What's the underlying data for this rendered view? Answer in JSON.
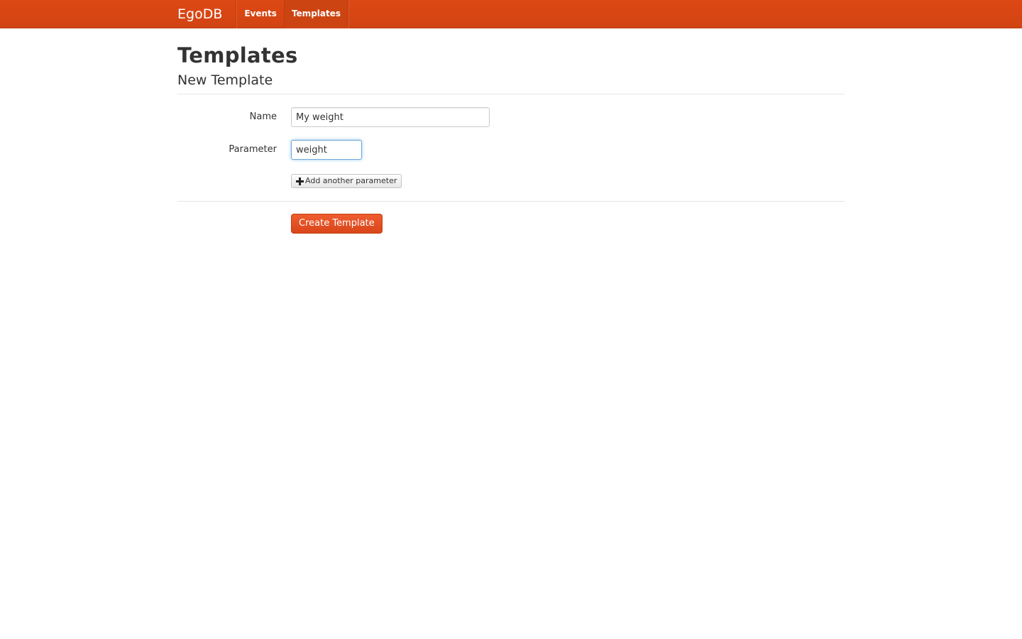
{
  "navbar": {
    "brand": "EgoDB",
    "items": [
      {
        "label": "Events"
      },
      {
        "label": "Templates"
      }
    ]
  },
  "page": {
    "title": "Templates",
    "subtitle": "New Template"
  },
  "form": {
    "name_label": "Name",
    "name_value": "My weight",
    "parameter_label": "Parameter",
    "parameter_value": "weight",
    "add_parameter_label": "Add another parameter",
    "submit_label": "Create Template"
  },
  "colors": {
    "navbar": "#dd4814",
    "primary_button": "#e4531f"
  }
}
